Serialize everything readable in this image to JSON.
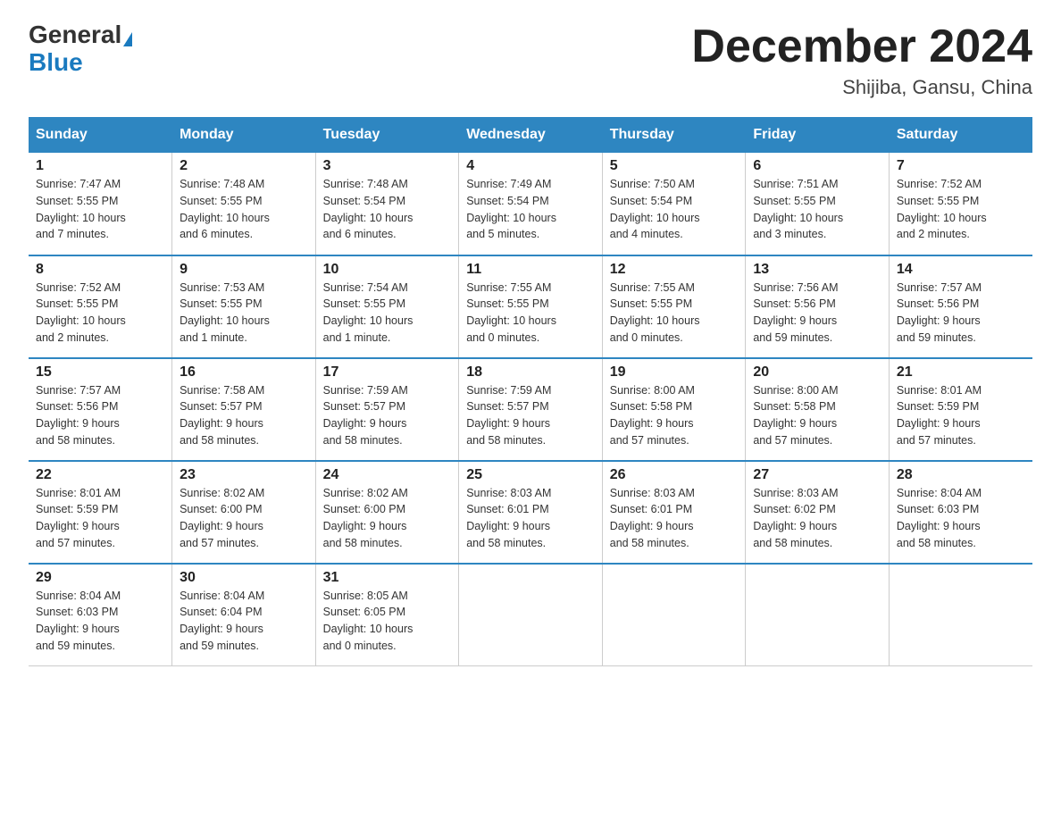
{
  "header": {
    "logo_general": "General",
    "logo_blue": "Blue",
    "title": "December 2024",
    "location": "Shijiba, Gansu, China"
  },
  "columns": [
    "Sunday",
    "Monday",
    "Tuesday",
    "Wednesday",
    "Thursday",
    "Friday",
    "Saturday"
  ],
  "weeks": [
    [
      {
        "day": "1",
        "sunrise": "7:47 AM",
        "sunset": "5:55 PM",
        "daylight": "10 hours and 7 minutes."
      },
      {
        "day": "2",
        "sunrise": "7:48 AM",
        "sunset": "5:55 PM",
        "daylight": "10 hours and 6 minutes."
      },
      {
        "day": "3",
        "sunrise": "7:48 AM",
        "sunset": "5:54 PM",
        "daylight": "10 hours and 6 minutes."
      },
      {
        "day": "4",
        "sunrise": "7:49 AM",
        "sunset": "5:54 PM",
        "daylight": "10 hours and 5 minutes."
      },
      {
        "day": "5",
        "sunrise": "7:50 AM",
        "sunset": "5:54 PM",
        "daylight": "10 hours and 4 minutes."
      },
      {
        "day": "6",
        "sunrise": "7:51 AM",
        "sunset": "5:55 PM",
        "daylight": "10 hours and 3 minutes."
      },
      {
        "day": "7",
        "sunrise": "7:52 AM",
        "sunset": "5:55 PM",
        "daylight": "10 hours and 2 minutes."
      }
    ],
    [
      {
        "day": "8",
        "sunrise": "7:52 AM",
        "sunset": "5:55 PM",
        "daylight": "10 hours and 2 minutes."
      },
      {
        "day": "9",
        "sunrise": "7:53 AM",
        "sunset": "5:55 PM",
        "daylight": "10 hours and 1 minute."
      },
      {
        "day": "10",
        "sunrise": "7:54 AM",
        "sunset": "5:55 PM",
        "daylight": "10 hours and 1 minute."
      },
      {
        "day": "11",
        "sunrise": "7:55 AM",
        "sunset": "5:55 PM",
        "daylight": "10 hours and 0 minutes."
      },
      {
        "day": "12",
        "sunrise": "7:55 AM",
        "sunset": "5:55 PM",
        "daylight": "10 hours and 0 minutes."
      },
      {
        "day": "13",
        "sunrise": "7:56 AM",
        "sunset": "5:56 PM",
        "daylight": "9 hours and 59 minutes."
      },
      {
        "day": "14",
        "sunrise": "7:57 AM",
        "sunset": "5:56 PM",
        "daylight": "9 hours and 59 minutes."
      }
    ],
    [
      {
        "day": "15",
        "sunrise": "7:57 AM",
        "sunset": "5:56 PM",
        "daylight": "9 hours and 58 minutes."
      },
      {
        "day": "16",
        "sunrise": "7:58 AM",
        "sunset": "5:57 PM",
        "daylight": "9 hours and 58 minutes."
      },
      {
        "day": "17",
        "sunrise": "7:59 AM",
        "sunset": "5:57 PM",
        "daylight": "9 hours and 58 minutes."
      },
      {
        "day": "18",
        "sunrise": "7:59 AM",
        "sunset": "5:57 PM",
        "daylight": "9 hours and 58 minutes."
      },
      {
        "day": "19",
        "sunrise": "8:00 AM",
        "sunset": "5:58 PM",
        "daylight": "9 hours and 57 minutes."
      },
      {
        "day": "20",
        "sunrise": "8:00 AM",
        "sunset": "5:58 PM",
        "daylight": "9 hours and 57 minutes."
      },
      {
        "day": "21",
        "sunrise": "8:01 AM",
        "sunset": "5:59 PM",
        "daylight": "9 hours and 57 minutes."
      }
    ],
    [
      {
        "day": "22",
        "sunrise": "8:01 AM",
        "sunset": "5:59 PM",
        "daylight": "9 hours and 57 minutes."
      },
      {
        "day": "23",
        "sunrise": "8:02 AM",
        "sunset": "6:00 PM",
        "daylight": "9 hours and 57 minutes."
      },
      {
        "day": "24",
        "sunrise": "8:02 AM",
        "sunset": "6:00 PM",
        "daylight": "9 hours and 58 minutes."
      },
      {
        "day": "25",
        "sunrise": "8:03 AM",
        "sunset": "6:01 PM",
        "daylight": "9 hours and 58 minutes."
      },
      {
        "day": "26",
        "sunrise": "8:03 AM",
        "sunset": "6:01 PM",
        "daylight": "9 hours and 58 minutes."
      },
      {
        "day": "27",
        "sunrise": "8:03 AM",
        "sunset": "6:02 PM",
        "daylight": "9 hours and 58 minutes."
      },
      {
        "day": "28",
        "sunrise": "8:04 AM",
        "sunset": "6:03 PM",
        "daylight": "9 hours and 58 minutes."
      }
    ],
    [
      {
        "day": "29",
        "sunrise": "8:04 AM",
        "sunset": "6:03 PM",
        "daylight": "9 hours and 59 minutes."
      },
      {
        "day": "30",
        "sunrise": "8:04 AM",
        "sunset": "6:04 PM",
        "daylight": "9 hours and 59 minutes."
      },
      {
        "day": "31",
        "sunrise": "8:05 AM",
        "sunset": "6:05 PM",
        "daylight": "10 hours and 0 minutes."
      },
      null,
      null,
      null,
      null
    ]
  ],
  "sunrise_label": "Sunrise:",
  "sunset_label": "Sunset:",
  "daylight_label": "Daylight:"
}
